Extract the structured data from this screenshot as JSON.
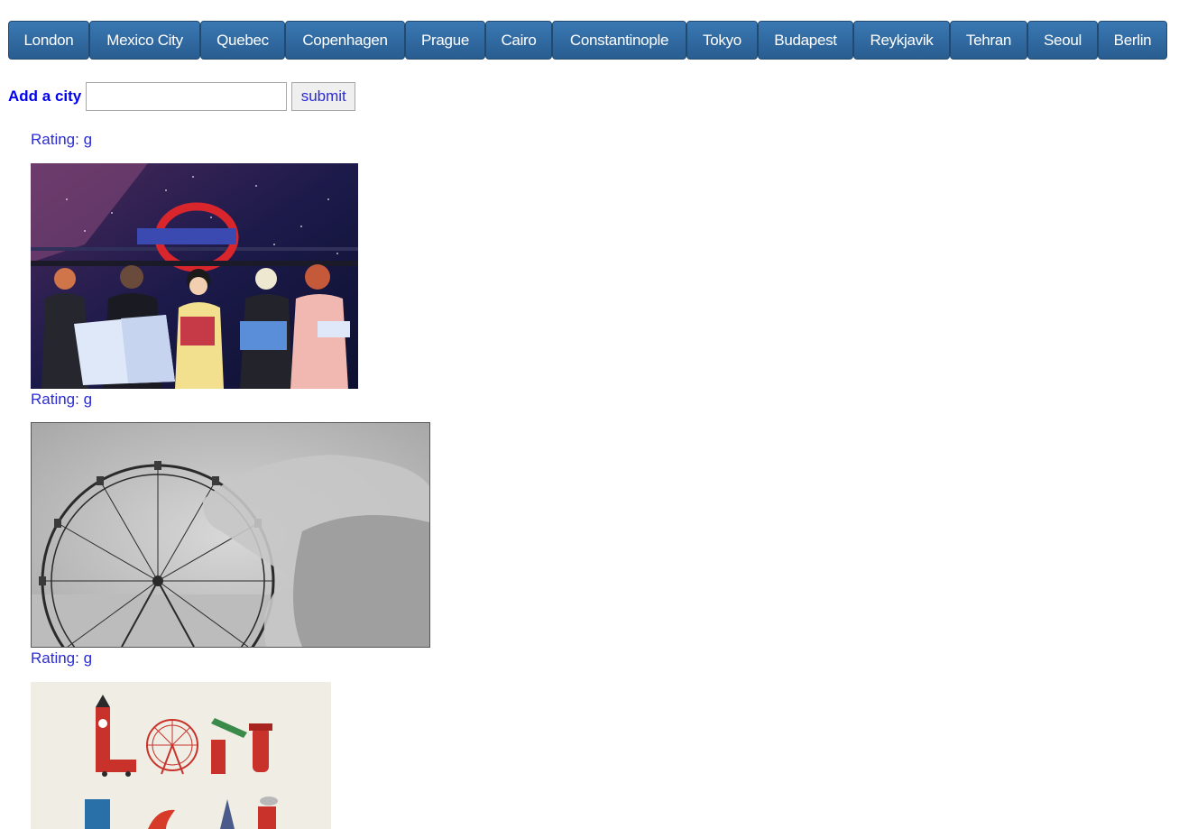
{
  "cities": [
    "London",
    "Mexico City",
    "Quebec",
    "Copenhagen",
    "Prague",
    "Cairo",
    "Constantinople",
    "Tokyo",
    "Budapest",
    "Reykjavik",
    "Tehran",
    "Seoul",
    "Berlin"
  ],
  "form": {
    "label": "Add a city",
    "input_value": "",
    "submit_label": "submit"
  },
  "gifs": [
    {
      "rating": "Rating: g"
    },
    {
      "rating": "Rating: g"
    },
    {
      "rating": "Rating: g"
    }
  ],
  "colors": {
    "button_top": "#3a78b3",
    "button_bottom": "#285d90",
    "link": "#0000ee"
  }
}
